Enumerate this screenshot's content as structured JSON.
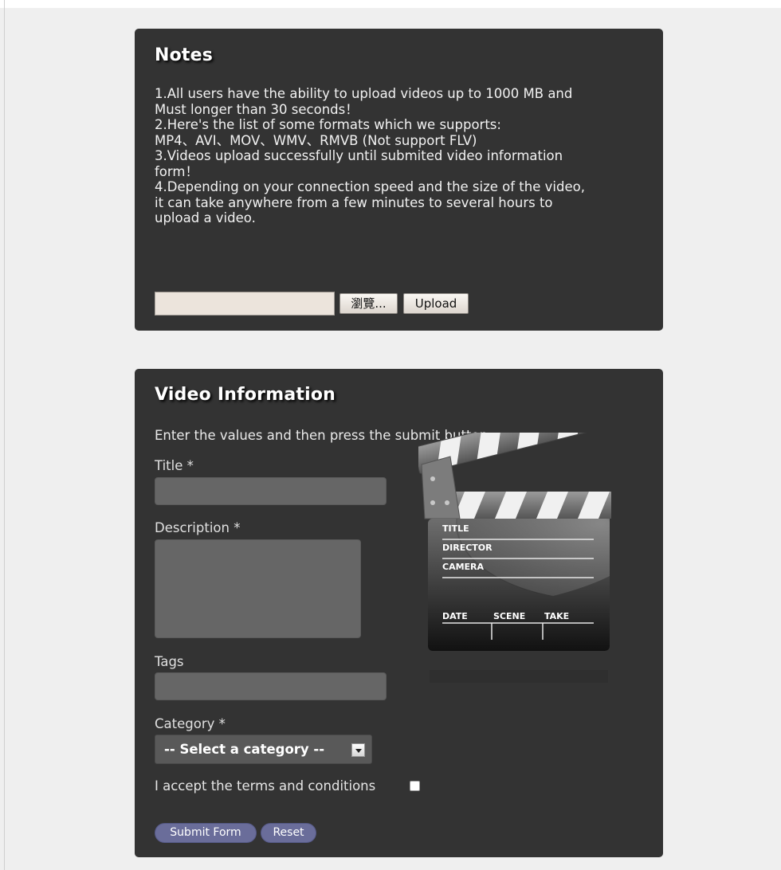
{
  "notes": {
    "title": "Notes",
    "lines": [
      "1.All users have the ability to upload videos up to 1000 MB and",
      "Must longer than 30 seconds！",
      "2.Here's the list of some formats which we supports:",
      "MP4、AVI、MOV、WMV、RMVB (Not support FLV)",
      "3.Videos upload successfully until submited video information",
      "form！",
      "4.Depending on your connection speed and the size of the video,",
      "it can take anywhere from a few minutes to several hours to",
      "upload a video."
    ],
    "file_input": {
      "value": ""
    },
    "browse_label": "瀏覽...",
    "upload_label": "Upload"
  },
  "video_info": {
    "title": "Video Information",
    "intro": "Enter the values and then press the submit button.",
    "fields": {
      "title_label": "Title *",
      "title_value": "",
      "description_label": "Description *",
      "description_value": "",
      "tags_label": "Tags",
      "tags_value": "",
      "category_label": "Category *",
      "category_selected": "-- Select a category --"
    },
    "terms_label": "I accept the terms and conditions",
    "terms_checked": false,
    "submit_label": "Submit Form",
    "reset_label": "Reset",
    "clapperboard": {
      "labels": [
        "TITLE",
        "DIRECTOR",
        "CAMERA"
      ],
      "bottom_labels": [
        "DATE",
        "SCENE",
        "TAKE"
      ]
    }
  },
  "colors": {
    "page_bg": "#efefef",
    "panel_bg": "#333333",
    "input_bg": "#666666",
    "select_bg": "#595959",
    "button_accent": "#6a6d9a",
    "file_field_bg": "#ece4dc"
  }
}
